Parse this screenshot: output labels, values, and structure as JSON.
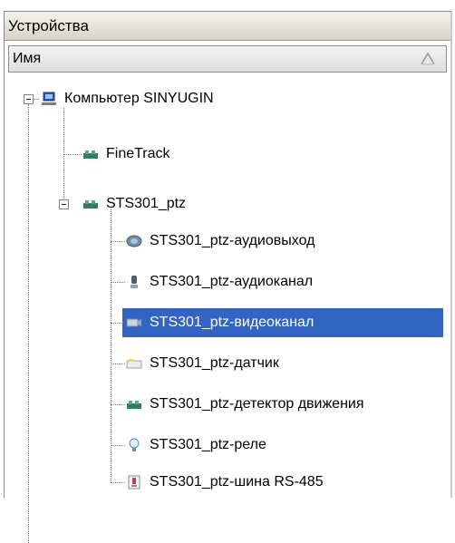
{
  "panel": {
    "title": "Устройства"
  },
  "column_header": {
    "name": "Имя",
    "sort_icon": "sort-ascending-icon"
  },
  "tree": {
    "root": {
      "label": "Компьютер SINYUGIN",
      "icon": "computer-icon"
    },
    "children": [
      {
        "label": "FineTrack",
        "icon": "device-icon"
      },
      {
        "label": "STS301_ptz",
        "icon": "device-icon",
        "children": [
          {
            "label": "STS301_ptz-аудиовыход",
            "icon": "speaker-icon"
          },
          {
            "label": "STS301_ptz-аудиоканал",
            "icon": "microphone-icon"
          },
          {
            "label": "STS301_ptz-видеоканал",
            "icon": "camera-icon",
            "selected": true
          },
          {
            "label": "STS301_ptz-датчик",
            "icon": "sensor-icon"
          },
          {
            "label": "STS301_ptz-детектор движения",
            "icon": "motion-detector-icon"
          },
          {
            "label": "STS301_ptz-реле",
            "icon": "relay-bulb-icon"
          },
          {
            "label": "STS301_ptz-шина RS-485",
            "icon": "rs485-bus-icon"
          }
        ]
      }
    ]
  },
  "colors": {
    "selection": "#3264c3",
    "header_bg": "#d6d3c9"
  }
}
